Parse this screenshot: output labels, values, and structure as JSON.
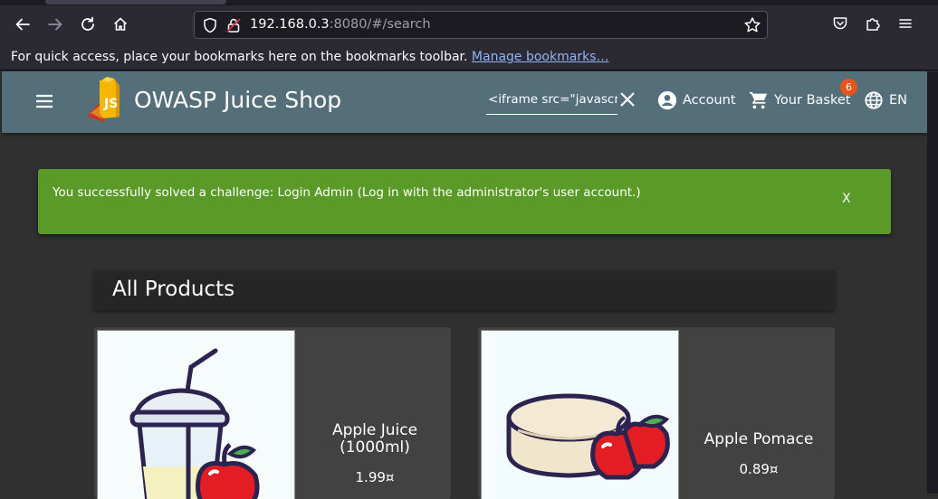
{
  "browser": {
    "url_host": "192.168.0.3",
    "url_rest": ":8080/#/search",
    "bookmarks_hint": "For quick access, place your bookmarks here on the bookmarks toolbar.",
    "bookmarks_link": "Manage bookmarks…"
  },
  "header": {
    "title": "OWASP Juice Shop",
    "search_value": "<iframe src=\"javascri",
    "account_label": "Account",
    "basket_label": "Your Basket",
    "basket_count": "6",
    "language_label": "EN"
  },
  "banner": {
    "message": "You successfully solved a challenge: Login Admin (Log in with the administrator's user account.)",
    "close_label": "X"
  },
  "products": {
    "heading": "All Products",
    "items": [
      {
        "name_line1": "Apple Juice",
        "name_line2": "(1000ml)",
        "price": "1.99¤"
      },
      {
        "name_line1": "Apple Pomace",
        "name_line2": "",
        "price": "0.89¤"
      }
    ]
  },
  "colors": {
    "header_bg": "#546e7a",
    "banner_bg": "#5a9a28",
    "badge": "#e8541c",
    "page_bg": "#303030",
    "card_bg": "#424242"
  }
}
